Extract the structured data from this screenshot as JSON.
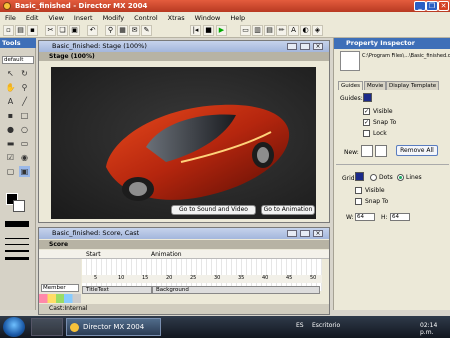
{
  "titlebar": {
    "title": "Basic_finished - Director MX 2004"
  },
  "menu": [
    "File",
    "Edit",
    "View",
    "Insert",
    "Modify",
    "Control",
    "Xtras",
    "Window",
    "Help"
  ],
  "tools": {
    "title": "Tools",
    "mode": "default"
  },
  "stage_window": {
    "title": "Basic_finished: Stage (100%)",
    "label": "Stage (100%)",
    "buttons": [
      "Go to Sound and Video",
      "Go to Animation"
    ]
  },
  "score_window": {
    "title": "Basic_finished: Score, Cast",
    "label": "Score",
    "member": "Member",
    "markers": [
      "Start",
      "Animation"
    ],
    "frame_numbers": [
      "5",
      "10",
      "15",
      "20",
      "25",
      "30",
      "35",
      "40",
      "45",
      "50"
    ],
    "sprites": [
      "TitleText",
      "Background"
    ],
    "cast_label": "Cast:Internal"
  },
  "property_inspector": {
    "title": "Property Inspector",
    "path": "C:\\Program Files\\...\\Basic_finished.dir",
    "tabs": [
      "Guides",
      "Movie",
      "Display Template"
    ],
    "guides_label": "Guides:",
    "visible": "Visible",
    "snap_to": "Snap To",
    "lock": "Lock",
    "new_label": "New:",
    "remove_all": "Remove All",
    "grid_label": "Grid:",
    "dots": "Dots",
    "lines": "Lines",
    "grid_visible": "Visible",
    "grid_snap": "Snap To",
    "w_label": "W:",
    "w_value": "64",
    "h_label": "H:",
    "h_value": "64"
  },
  "taskbar": {
    "app": "Director MX 2004",
    "lang": "ES",
    "desktop": "Escritorio",
    "time": "02:14 p.m."
  }
}
